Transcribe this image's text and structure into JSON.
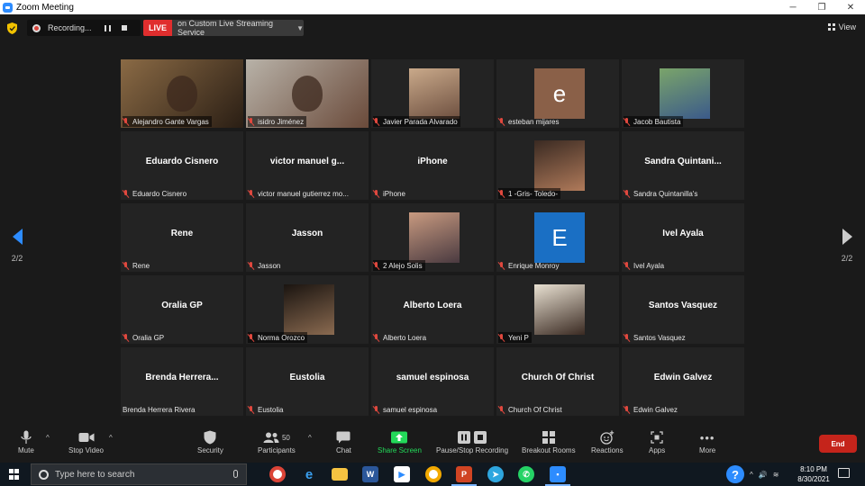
{
  "window": {
    "title": "Zoom Meeting",
    "minimize": "─",
    "maximize": "❐",
    "close": "✕"
  },
  "status": {
    "recording_label": "Recording...",
    "live_badge": "LIVE",
    "live_service": "on Custom Live Streaming Service",
    "view_label": "View"
  },
  "navigation": {
    "page_left": "2/2",
    "page_right": "2/2"
  },
  "participants": [
    {
      "big_name": "",
      "label": "Alejandro Gante Vargas",
      "kind": "video",
      "colors": [
        "#8a6a45",
        "#2a1e14"
      ]
    },
    {
      "big_name": "",
      "label": "isidro Jiménez",
      "kind": "video",
      "colors": [
        "#b8b2a8",
        "#6a4a3a"
      ]
    },
    {
      "big_name": "",
      "label": "Javier Parada Alvarado",
      "kind": "avatar",
      "colors": [
        "#c9a98a",
        "#6e5040"
      ]
    },
    {
      "big_name": "",
      "label": "esteban mijares",
      "kind": "letter",
      "letter": "e",
      "colors": [
        "#8a6048",
        "#8a6048"
      ]
    },
    {
      "big_name": "",
      "label": "Jacob Bautista",
      "kind": "avatar",
      "colors": [
        "#7aa46a",
        "#3b5a8a"
      ]
    },
    {
      "big_name": "Eduardo Cisnero",
      "label": "Eduardo Cisnero",
      "kind": "name"
    },
    {
      "big_name": "victor manuel g...",
      "label": "victor manuel gutierrez mo...",
      "kind": "name"
    },
    {
      "big_name": "iPhone",
      "label": "iPhone",
      "kind": "name"
    },
    {
      "big_name": "",
      "label": "1 -Gris- Toledo-",
      "kind": "avatar",
      "colors": [
        "#3a2a22",
        "#b07a5a"
      ]
    },
    {
      "big_name": "Sandra  Quintani...",
      "label": "Sandra Quintanilla's",
      "kind": "name"
    },
    {
      "big_name": "Rene",
      "label": "Rene",
      "kind": "name"
    },
    {
      "big_name": "Jasson",
      "label": "Jasson",
      "kind": "name"
    },
    {
      "big_name": "",
      "label": "2 Alejo Solis",
      "kind": "avatar",
      "colors": [
        "#c89a80",
        "#4a3a40"
      ]
    },
    {
      "big_name": "",
      "label": "Enrique Monroy",
      "kind": "letter",
      "letter": "E",
      "colors": [
        "#1a6fc4",
        "#1a6fc4"
      ]
    },
    {
      "big_name": "Ivel Ayala",
      "label": "Ivel Ayala",
      "kind": "name"
    },
    {
      "big_name": "Oralia GP",
      "label": "Oralia GP",
      "kind": "name"
    },
    {
      "big_name": "",
      "label": "Norma Orozco",
      "kind": "avatar",
      "colors": [
        "#1a1410",
        "#8a6a50"
      ]
    },
    {
      "big_name": "Alberto Loera",
      "label": "Alberto Loera",
      "kind": "name"
    },
    {
      "big_name": "",
      "label": "Yeni P",
      "kind": "avatar",
      "colors": [
        "#e9e1d2",
        "#3a2a22"
      ]
    },
    {
      "big_name": "Santos Vasquez",
      "label": "Santos Vasquez",
      "kind": "name"
    },
    {
      "big_name": "Brenda  Herrera...",
      "label": "Brenda Herrera Rivera",
      "kind": "name",
      "nomic": true
    },
    {
      "big_name": "Eustolia",
      "label": "Eustolia",
      "kind": "name"
    },
    {
      "big_name": "samuel espinosa",
      "label": "samuel espinosa",
      "kind": "name"
    },
    {
      "big_name": "Church Of Christ",
      "label": "Church Of Christ",
      "kind": "name"
    },
    {
      "big_name": "Edwin Galvez",
      "label": "Edwin Galvez",
      "kind": "name"
    }
  ],
  "toolbar": {
    "mute": "Mute",
    "stop_video": "Stop Video",
    "security": "Security",
    "participants": "Participants",
    "participants_count": "50",
    "chat": "Chat",
    "share_screen": "Share Screen",
    "pause_stop_recording": "Pause/Stop Recording",
    "breakout_rooms": "Breakout Rooms",
    "reactions": "Reactions",
    "apps": "Apps",
    "more": "More",
    "end": "End",
    "share_color": "#23d959"
  },
  "taskbar": {
    "search_placeholder": "Type here to search",
    "time": "8:10 PM",
    "date": "8/30/2021"
  }
}
